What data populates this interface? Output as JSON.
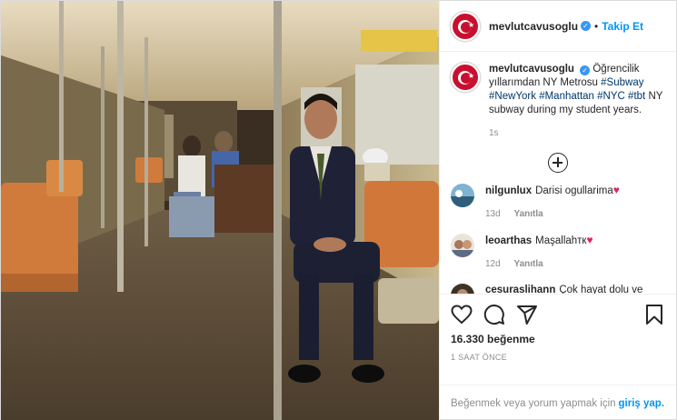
{
  "account": {
    "username": "mevlutcavusoglu",
    "follow_label": "Takip Et",
    "separator": "•",
    "verified_glyph": "✓"
  },
  "caption": {
    "username": "mevlutcavusoglu",
    "text_prefix": "Öğrencilik yıllarımdan NY Metrosu",
    "hashtags": [
      "#Subway",
      "#NewYork",
      "#Manhattan",
      "#NYC",
      "#tbt"
    ],
    "text_suffix": "NY subway during my student years.",
    "time": "1s"
  },
  "comments": [
    {
      "username": "nilgunlux",
      "text": "Darisi ogullarima",
      "emoji": "♥",
      "time": "13d",
      "reply_label": "Yanıtla"
    },
    {
      "username": "leoarthas",
      "text": "Maşallahтк",
      "emoji": "♥",
      "time": "12d",
      "reply_label": "Yanıtla"
    },
    {
      "username": "cesuraslihann",
      "text": "Çok hayat dolu ve",
      "emoji": "",
      "time": "",
      "reply_label": ""
    }
  ],
  "actions": {
    "icons": [
      "heart-icon",
      "comment-icon",
      "share-icon",
      "bookmark-icon"
    ]
  },
  "likes": "16.330 beğenme",
  "timestamp": "1 SAAT ÖNCE",
  "login_prompt": {
    "text": "Beğenmek veya yorum yapmak için",
    "link": "giriş yap."
  },
  "colors": {
    "accent": "#0095f6",
    "verified": "#3897f0",
    "flag_red": "#c8102e",
    "heart_red": "#e0245e"
  }
}
